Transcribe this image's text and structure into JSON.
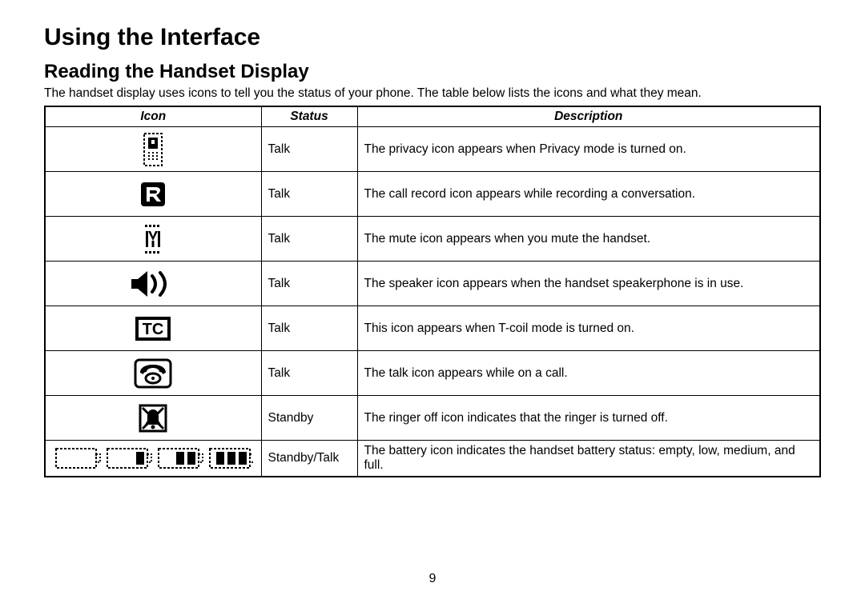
{
  "heading": "Using the Interface",
  "subheading": "Reading the Handset Display",
  "intro": "The handset display uses icons to tell you the status of your phone. The table below lists the icons and what they mean.",
  "columns": {
    "icon": "Icon",
    "status": "Status",
    "description": "Description"
  },
  "rows": [
    {
      "icon": "privacy-icon",
      "status": "Talk",
      "description": "The privacy icon appears when Privacy mode is turned on."
    },
    {
      "icon": "record-icon",
      "status": "Talk",
      "description": "The call record icon appears while recording a conversation."
    },
    {
      "icon": "mute-icon",
      "status": "Talk",
      "description": "The mute icon appears when you mute the handset."
    },
    {
      "icon": "speaker-icon",
      "status": "Talk",
      "description": "The speaker icon appears when the handset speakerphone is in use."
    },
    {
      "icon": "tcoil-icon",
      "status": "Talk",
      "description": "This icon appears when T-coil mode is turned on."
    },
    {
      "icon": "talk-icon",
      "status": "Talk",
      "description": "The talk icon appears while on a call."
    },
    {
      "icon": "ringeroff-icon",
      "status": "Standby",
      "description": "The ringer off icon indicates that the ringer is turned off."
    },
    {
      "icon": "battery-icon",
      "status": "Standby/Talk",
      "description": "The battery icon indicates the handset battery status: empty, low, medium, and full."
    }
  ],
  "page_number": "9"
}
